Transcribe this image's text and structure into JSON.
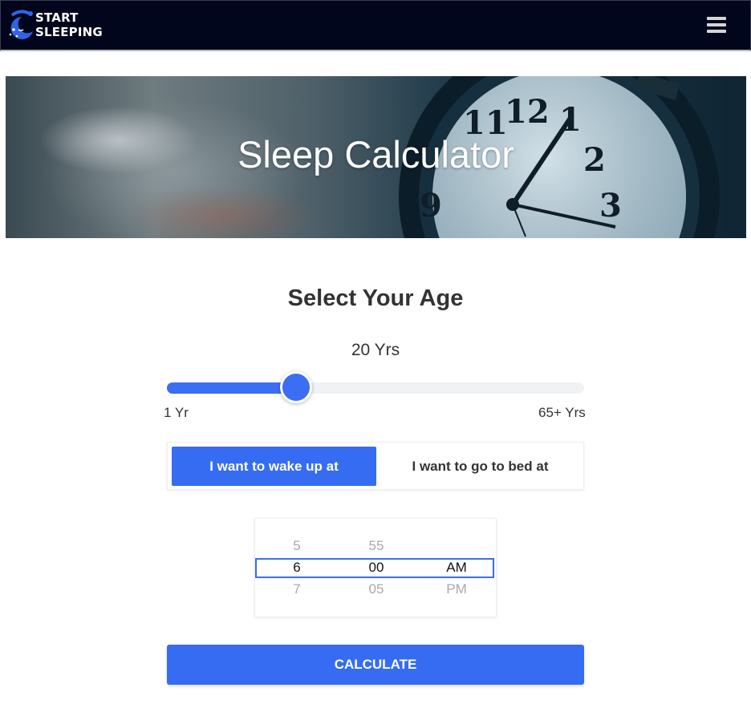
{
  "header": {
    "logo_line1": "START",
    "logo_line2": "SLEEPING",
    "menu_icon": "hamburger-menu-icon"
  },
  "hero": {
    "title": "Sleep Calculator"
  },
  "age": {
    "heading": "Select Your Age",
    "value_label": "20 Yrs",
    "slider_fraction": 0.31,
    "min_label": "1 Yr",
    "max_label": "65+ Yrs"
  },
  "mode_toggle": {
    "wake_label": "I want to wake up at",
    "bed_label": "I want to go to bed at",
    "selected": "wake"
  },
  "time_picker": {
    "hours": {
      "prev": "5",
      "current": "6",
      "next": "7"
    },
    "minutes": {
      "prev": "55",
      "current": "00",
      "next": "05"
    },
    "period": {
      "prev": "",
      "current": "AM",
      "next": "PM"
    }
  },
  "actions": {
    "calculate_label": "CALCULATE"
  },
  "colors": {
    "accent": "#356cf2",
    "navbar": "#02061c"
  }
}
